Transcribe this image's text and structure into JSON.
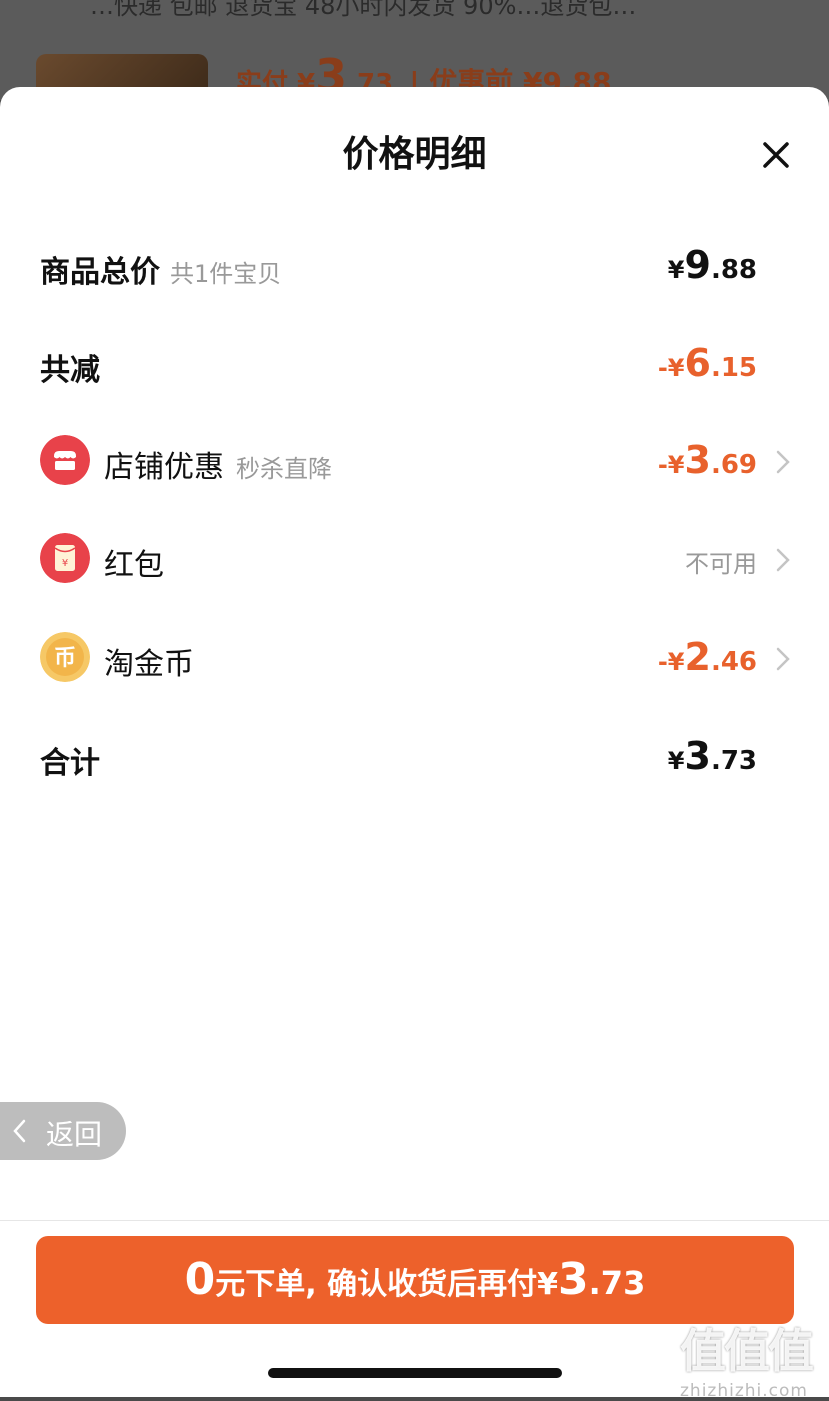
{
  "background": {
    "partial_text": "…快递 包邮 退货宝 48小时内发货 90%…退货包…",
    "price_prefix": "实付 ¥",
    "price_int": "3",
    "price_dec": ".73",
    "original_price": "| 优惠前 ¥9.88"
  },
  "sheet": {
    "title": "价格明细",
    "close_icon": "close-icon"
  },
  "rows": {
    "total": {
      "label": "商品总价",
      "sub": "共1件宝贝",
      "yen": "¥",
      "int": "9",
      "dec": ".88"
    },
    "reduce": {
      "label": "共减",
      "yen": "-¥",
      "int": "6",
      "dec": ".15"
    },
    "shop": {
      "label": "店铺优惠",
      "sub": "秒杀直降",
      "yen": "-¥",
      "int": "3",
      "dec": ".69",
      "icon": "shop-icon"
    },
    "redpacket": {
      "label": "红包",
      "status": "不可用",
      "icon": "red-packet-icon"
    },
    "coin": {
      "label": "淘金币",
      "yen": "-¥",
      "int": "2",
      "dec": ".46",
      "icon": "coin-icon"
    },
    "sum": {
      "label": "合计",
      "yen": "¥",
      "int": "3",
      "dec": ".73"
    }
  },
  "back_button": {
    "label": "返回"
  },
  "pay_button": {
    "zero": "0",
    "text": "元下单, 确认收货后再付",
    "yen": "¥",
    "int": "3",
    "dec": ".73"
  },
  "watermark": {
    "glyphs": "值值值",
    "site": "zhizhizhi.com"
  },
  "colors": {
    "accent": "#ed612b",
    "price_orange": "#e8612c",
    "shop_icon": "#e8424a",
    "coin_icon": "#f2b54a"
  }
}
